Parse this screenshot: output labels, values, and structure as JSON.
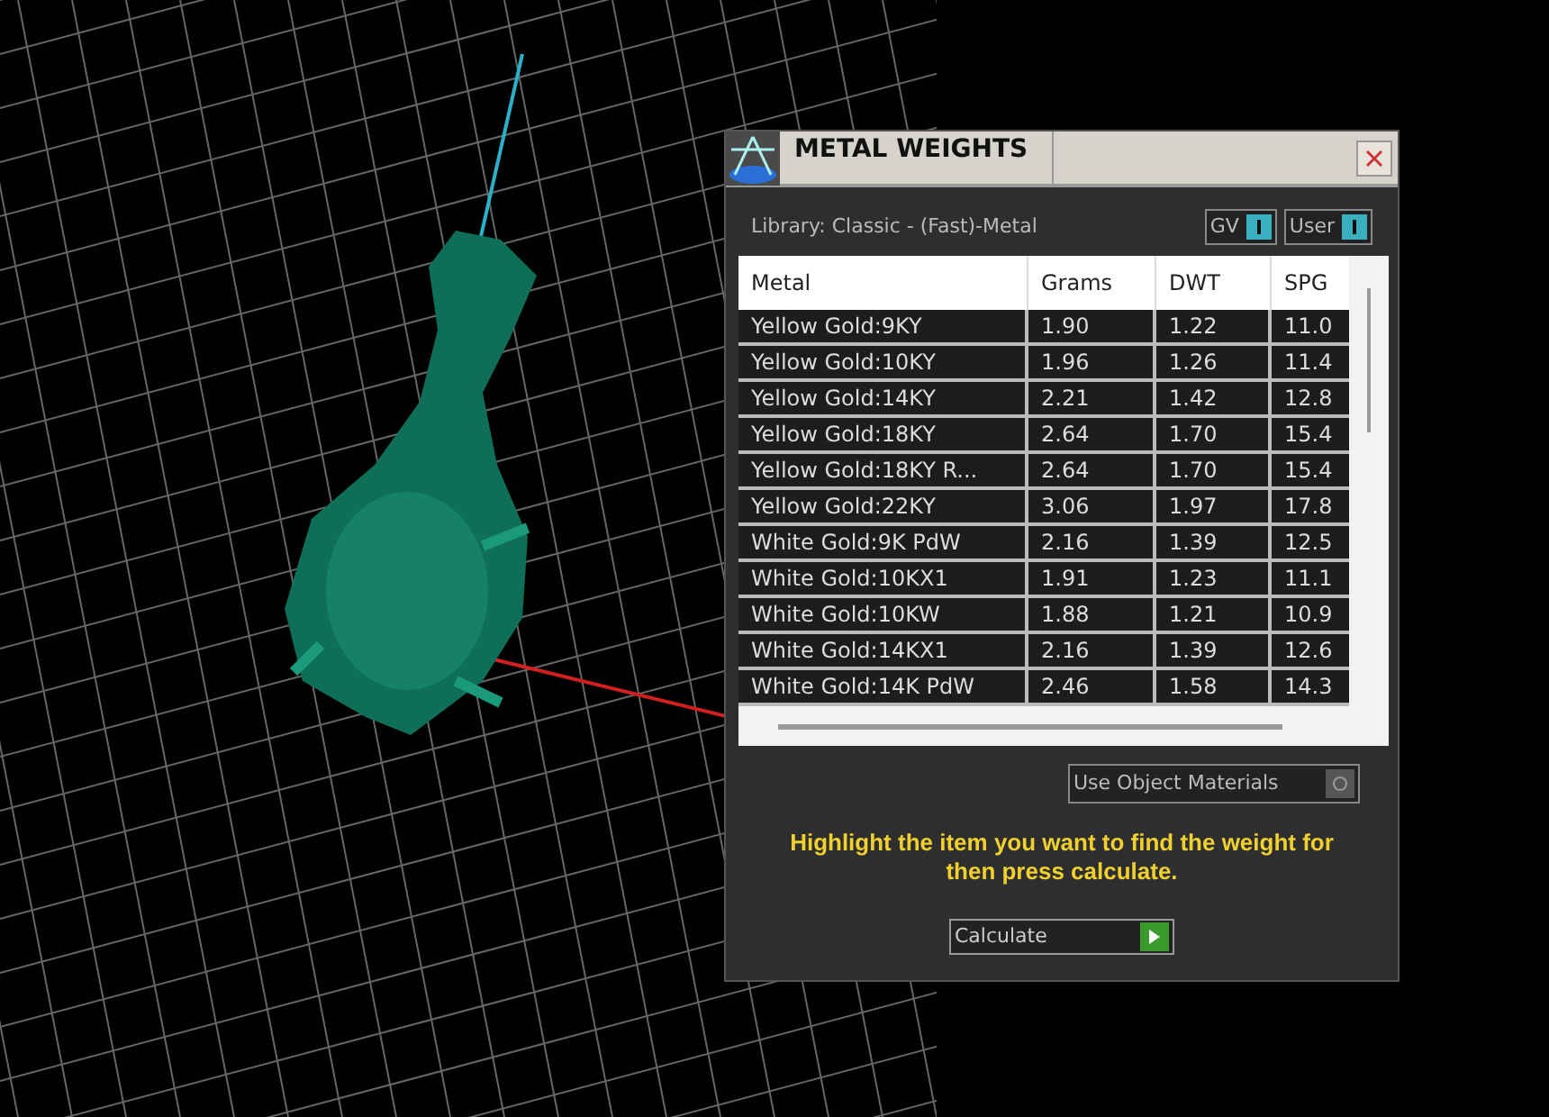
{
  "window": {
    "title": "METAL WEIGHTS"
  },
  "library_label": "Library: Classic - (Fast)-Metal",
  "toggles": [
    {
      "label": "GV",
      "on": true
    },
    {
      "label": "User",
      "on": true
    }
  ],
  "table": {
    "columns": [
      "Metal",
      "Grams",
      "DWT",
      "SPG"
    ],
    "rows": [
      [
        "Yellow Gold:9KY",
        "1.90",
        "1.22",
        "11.0"
      ],
      [
        "Yellow Gold:10KY",
        "1.96",
        "1.26",
        "11.4"
      ],
      [
        "Yellow Gold:14KY",
        "2.21",
        "1.42",
        "12.8"
      ],
      [
        "Yellow Gold:18KY",
        "2.64",
        "1.70",
        "15.4"
      ],
      [
        "Yellow Gold:18KY R...",
        "2.64",
        "1.70",
        "15.4"
      ],
      [
        "Yellow Gold:22KY",
        "3.06",
        "1.97",
        "17.8"
      ],
      [
        "White Gold:9K PdW",
        "2.16",
        "1.39",
        "12.5"
      ],
      [
        "White Gold:10KX1",
        "1.91",
        "1.23",
        "11.1"
      ],
      [
        "White Gold:10KW",
        "1.88",
        "1.21",
        "10.9"
      ],
      [
        "White Gold:14KX1",
        "2.16",
        "1.39",
        "12.6"
      ],
      [
        "White Gold:14K PdW",
        "2.46",
        "1.58",
        "14.3"
      ]
    ]
  },
  "use_object_materials": {
    "label": "Use Object Materials",
    "checked": false
  },
  "hint": "Highlight the item you want to find the weight for then press calculate.",
  "calculate_button": "Calculate"
}
